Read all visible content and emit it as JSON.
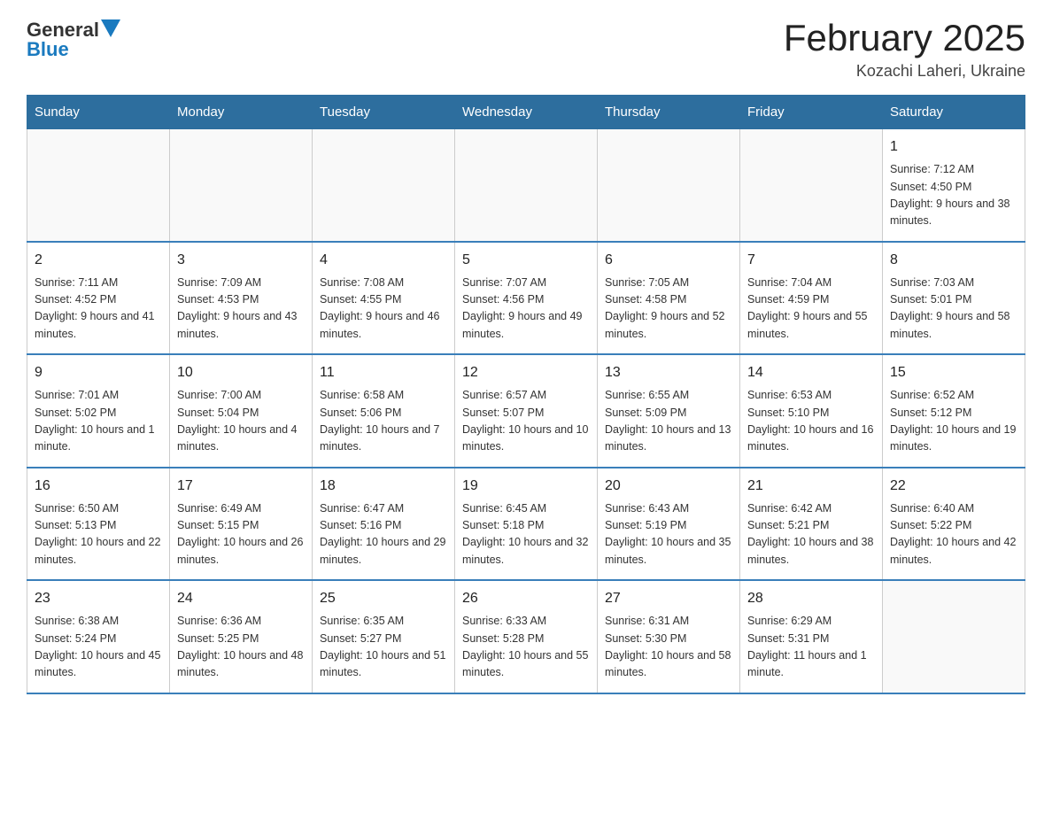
{
  "header": {
    "title": "February 2025",
    "subtitle": "Kozachi Laheri, Ukraine",
    "logo": {
      "general": "General",
      "blue": "Blue"
    }
  },
  "weekdays": [
    "Sunday",
    "Monday",
    "Tuesday",
    "Wednesday",
    "Thursday",
    "Friday",
    "Saturday"
  ],
  "weeks": [
    [
      {
        "day": "",
        "info": ""
      },
      {
        "day": "",
        "info": ""
      },
      {
        "day": "",
        "info": ""
      },
      {
        "day": "",
        "info": ""
      },
      {
        "day": "",
        "info": ""
      },
      {
        "day": "",
        "info": ""
      },
      {
        "day": "1",
        "info": "Sunrise: 7:12 AM\nSunset: 4:50 PM\nDaylight: 9 hours and 38 minutes."
      }
    ],
    [
      {
        "day": "2",
        "info": "Sunrise: 7:11 AM\nSunset: 4:52 PM\nDaylight: 9 hours and 41 minutes."
      },
      {
        "day": "3",
        "info": "Sunrise: 7:09 AM\nSunset: 4:53 PM\nDaylight: 9 hours and 43 minutes."
      },
      {
        "day": "4",
        "info": "Sunrise: 7:08 AM\nSunset: 4:55 PM\nDaylight: 9 hours and 46 minutes."
      },
      {
        "day": "5",
        "info": "Sunrise: 7:07 AM\nSunset: 4:56 PM\nDaylight: 9 hours and 49 minutes."
      },
      {
        "day": "6",
        "info": "Sunrise: 7:05 AM\nSunset: 4:58 PM\nDaylight: 9 hours and 52 minutes."
      },
      {
        "day": "7",
        "info": "Sunrise: 7:04 AM\nSunset: 4:59 PM\nDaylight: 9 hours and 55 minutes."
      },
      {
        "day": "8",
        "info": "Sunrise: 7:03 AM\nSunset: 5:01 PM\nDaylight: 9 hours and 58 minutes."
      }
    ],
    [
      {
        "day": "9",
        "info": "Sunrise: 7:01 AM\nSunset: 5:02 PM\nDaylight: 10 hours and 1 minute."
      },
      {
        "day": "10",
        "info": "Sunrise: 7:00 AM\nSunset: 5:04 PM\nDaylight: 10 hours and 4 minutes."
      },
      {
        "day": "11",
        "info": "Sunrise: 6:58 AM\nSunset: 5:06 PM\nDaylight: 10 hours and 7 minutes."
      },
      {
        "day": "12",
        "info": "Sunrise: 6:57 AM\nSunset: 5:07 PM\nDaylight: 10 hours and 10 minutes."
      },
      {
        "day": "13",
        "info": "Sunrise: 6:55 AM\nSunset: 5:09 PM\nDaylight: 10 hours and 13 minutes."
      },
      {
        "day": "14",
        "info": "Sunrise: 6:53 AM\nSunset: 5:10 PM\nDaylight: 10 hours and 16 minutes."
      },
      {
        "day": "15",
        "info": "Sunrise: 6:52 AM\nSunset: 5:12 PM\nDaylight: 10 hours and 19 minutes."
      }
    ],
    [
      {
        "day": "16",
        "info": "Sunrise: 6:50 AM\nSunset: 5:13 PM\nDaylight: 10 hours and 22 minutes."
      },
      {
        "day": "17",
        "info": "Sunrise: 6:49 AM\nSunset: 5:15 PM\nDaylight: 10 hours and 26 minutes."
      },
      {
        "day": "18",
        "info": "Sunrise: 6:47 AM\nSunset: 5:16 PM\nDaylight: 10 hours and 29 minutes."
      },
      {
        "day": "19",
        "info": "Sunrise: 6:45 AM\nSunset: 5:18 PM\nDaylight: 10 hours and 32 minutes."
      },
      {
        "day": "20",
        "info": "Sunrise: 6:43 AM\nSunset: 5:19 PM\nDaylight: 10 hours and 35 minutes."
      },
      {
        "day": "21",
        "info": "Sunrise: 6:42 AM\nSunset: 5:21 PM\nDaylight: 10 hours and 38 minutes."
      },
      {
        "day": "22",
        "info": "Sunrise: 6:40 AM\nSunset: 5:22 PM\nDaylight: 10 hours and 42 minutes."
      }
    ],
    [
      {
        "day": "23",
        "info": "Sunrise: 6:38 AM\nSunset: 5:24 PM\nDaylight: 10 hours and 45 minutes."
      },
      {
        "day": "24",
        "info": "Sunrise: 6:36 AM\nSunset: 5:25 PM\nDaylight: 10 hours and 48 minutes."
      },
      {
        "day": "25",
        "info": "Sunrise: 6:35 AM\nSunset: 5:27 PM\nDaylight: 10 hours and 51 minutes."
      },
      {
        "day": "26",
        "info": "Sunrise: 6:33 AM\nSunset: 5:28 PM\nDaylight: 10 hours and 55 minutes."
      },
      {
        "day": "27",
        "info": "Sunrise: 6:31 AM\nSunset: 5:30 PM\nDaylight: 10 hours and 58 minutes."
      },
      {
        "day": "28",
        "info": "Sunrise: 6:29 AM\nSunset: 5:31 PM\nDaylight: 11 hours and 1 minute."
      },
      {
        "day": "",
        "info": ""
      }
    ]
  ]
}
